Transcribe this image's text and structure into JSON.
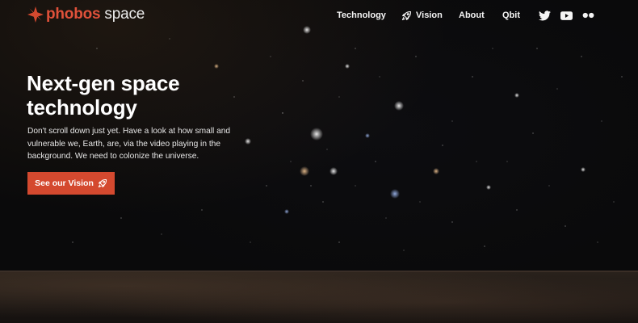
{
  "brand": {
    "name_primary": "phobos",
    "name_secondary": "space",
    "accent_color": "#d4492f",
    "logo_icon": "star-burst-icon"
  },
  "nav": {
    "items": [
      {
        "label": "Technology",
        "icon": null
      },
      {
        "label": "Vision",
        "icon": "rocket-icon"
      },
      {
        "label": "About",
        "icon": null
      },
      {
        "label": "Qbit",
        "icon": null
      }
    ],
    "social": [
      "twitter-icon",
      "youtube-icon",
      "flickr-icon"
    ]
  },
  "hero": {
    "title": "Next-gen space technology",
    "description": "Don't scroll down just yet. Have a look at how small and vulnerable we, Earth, are, via the video playing in the background. We need to colonize the universe.",
    "cta_label": "See our Vision",
    "cta_icon": "rocket-icon"
  }
}
